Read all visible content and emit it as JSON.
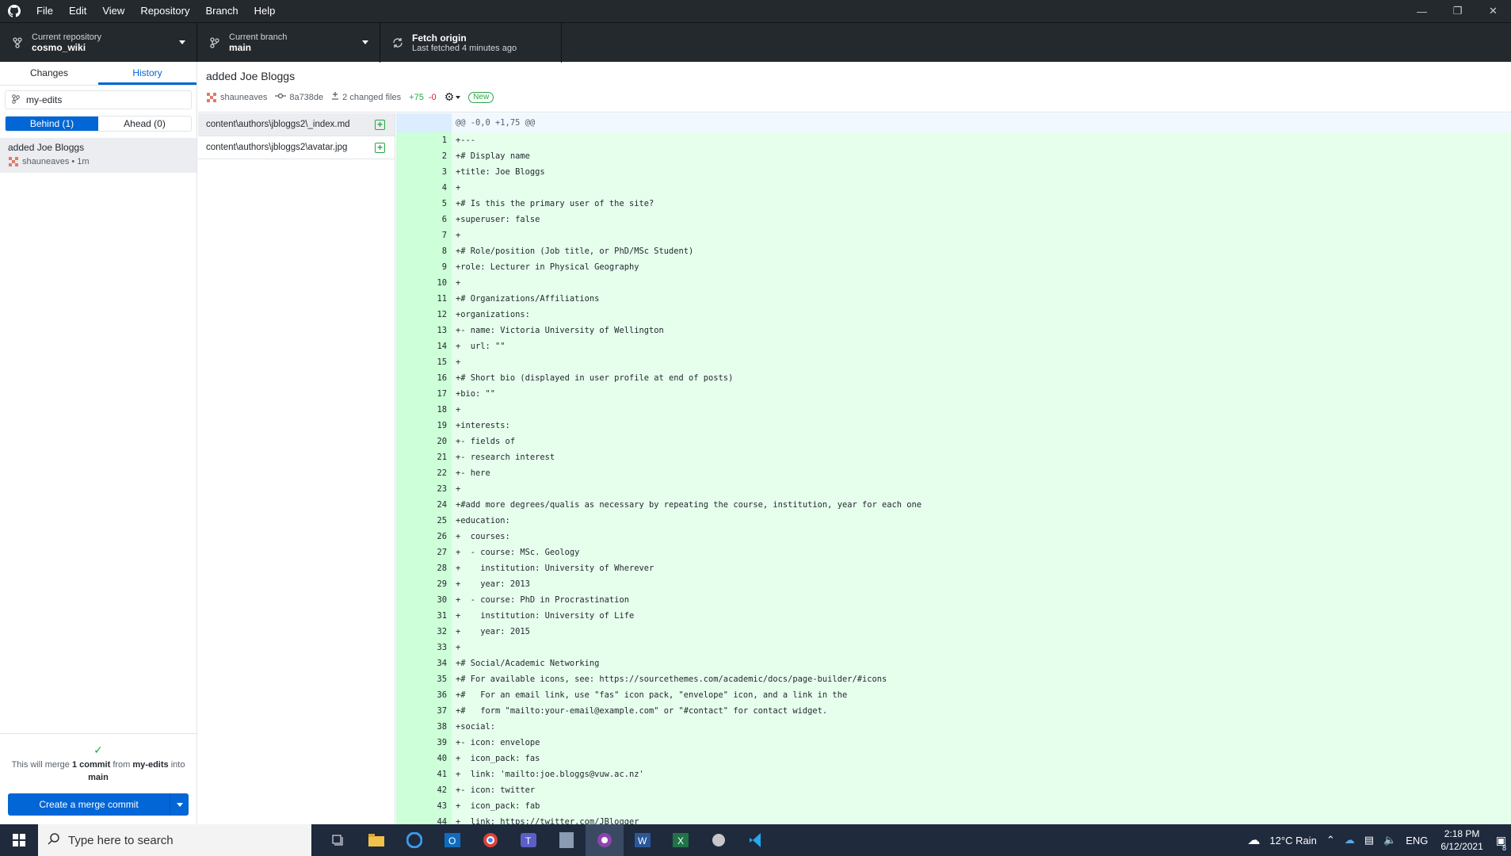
{
  "menu": [
    "File",
    "Edit",
    "View",
    "Repository",
    "Branch",
    "Help"
  ],
  "toolbar": {
    "repo_label": "Current repository",
    "repo_value": "cosmo_wiki",
    "branch_label": "Current branch",
    "branch_value": "main",
    "fetch_label": "Fetch origin",
    "fetch_sub": "Last fetched 4 minutes ago"
  },
  "sidebar": {
    "tab_changes": "Changes",
    "tab_history": "History",
    "branch_filter": "my-edits",
    "behind": "Behind (1)",
    "ahead": "Ahead (0)",
    "commit_title": "added Joe Bloggs",
    "commit_meta": "shauneaves • 1m",
    "merge_pre": "This will merge ",
    "merge_count": "1 commit",
    "merge_mid": " from ",
    "merge_branch": "my-edits",
    "merge_post": " into ",
    "merge_target": "main",
    "merge_button": "Create a merge commit"
  },
  "commit": {
    "title": "added Joe Bloggs",
    "author": "shauneaves",
    "sha": "8a738de",
    "changed": "2 changed files",
    "additions": "+75",
    "deletions": "-0",
    "badge": "New"
  },
  "files": [
    "content\\authors\\jbloggs2\\_index.md",
    "content\\authors\\jbloggs2\\avatar.jpg"
  ],
  "hunk": "@@ -0,0 +1,75 @@",
  "diff_lines": [
    "+---",
    "+# Display name",
    "+title: Joe Bloggs",
    "+",
    "+# Is this the primary user of the site?",
    "+superuser: false",
    "+",
    "+# Role/position (Job title, or PhD/MSc Student)",
    "+role: Lecturer in Physical Geography",
    "+",
    "+# Organizations/Affiliations",
    "+organizations:",
    "+- name: Victoria University of Wellington",
    "+  url: \"\"",
    "+",
    "+# Short bio (displayed in user profile at end of posts)",
    "+bio: \"\"",
    "+",
    "+interests:",
    "+- fields of",
    "+- research interest",
    "+- here",
    "+",
    "+#add more degrees/qualis as necessary by repeating the course, institution, year for each one",
    "+education:",
    "+  courses:",
    "+  - course: MSc. Geology",
    "+    institution: University of Wherever",
    "+    year: 2013",
    "+  - course: PhD in Procrastination",
    "+    institution: University of Life",
    "+    year: 2015",
    "+",
    "+# Social/Academic Networking",
    "+# For available icons, see: https://sourcethemes.com/academic/docs/page-builder/#icons",
    "+#   For an email link, use \"fas\" icon pack, \"envelope\" icon, and a link in the",
    "+#   form \"mailto:your-email@example.com\" or \"#contact\" for contact widget.",
    "+social:",
    "+- icon: envelope",
    "+  icon_pack: fas",
    "+  link: 'mailto:joe.bloggs@vuw.ac.nz'",
    "+- icon: twitter",
    "+  icon_pack: fab",
    "+  link: https://twitter.com/JBlogger"
  ],
  "taskbar": {
    "search_placeholder": "Type here to search",
    "weather": "12°C  Rain",
    "lang": "ENG",
    "time": "2:18 PM",
    "date": "6/12/2021",
    "notif_count": "8"
  },
  "colors": {
    "accent": "#0366d6",
    "add": "#28a745",
    "diff_bg": "#e6ffed",
    "chrome": "#24292e"
  }
}
